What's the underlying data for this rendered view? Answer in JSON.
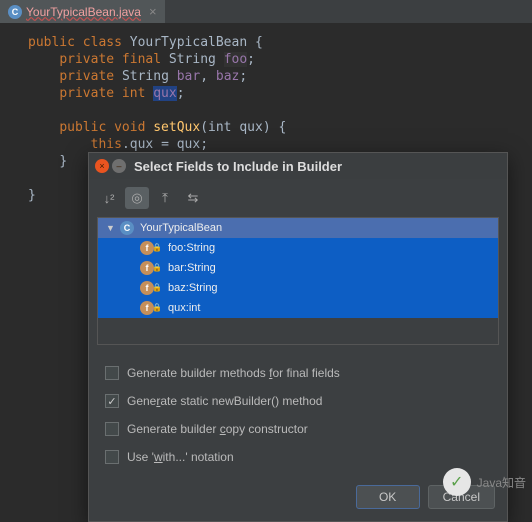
{
  "tab": {
    "filename": "YourTypicalBean.java",
    "icon_letter": "C"
  },
  "code": {
    "class_decl_kw": "public class ",
    "class_name": "YourTypicalBean",
    "lbrace": " {",
    "line1_kw": "private final ",
    "line1_type": "String ",
    "line1_field": "foo",
    "line2_kw": "private ",
    "line2_type": "String ",
    "line2_f1": "bar",
    "line2_f2": "baz",
    "line3_kw": "private int ",
    "line3_field": "qux",
    "semi": ";",
    "comma": ", ",
    "method_kw": "public void ",
    "method_name": "setQux",
    "method_params": "(int qux) {",
    "this": "this",
    "dot_qux": ".qux = qux;",
    "rbrace1": "}",
    "rbrace2": "}"
  },
  "dialog": {
    "title": "Select Fields to Include in Builder",
    "tree": {
      "class": "YourTypicalBean",
      "items": [
        {
          "name": "foo",
          "type": "String"
        },
        {
          "name": "bar",
          "type": "String"
        },
        {
          "name": "baz",
          "type": "String"
        },
        {
          "name": "qux",
          "type": "int"
        }
      ]
    },
    "checks": {
      "final_pre": "Generate builder methods ",
      "final_u": "f",
      "final_post": "or final fields",
      "static_pre": "Gene",
      "static_u": "r",
      "static_post": "ate static newBuilder() method",
      "copy_pre": "Generate builder ",
      "copy_u": "c",
      "copy_post": "opy constructor",
      "with_pre": "Use '",
      "with_u": "w",
      "with_post": "ith...' notation"
    },
    "buttons": {
      "ok": "OK",
      "cancel": "Cancel"
    }
  },
  "watermark": {
    "text": "Java知音",
    "glyph": "✓"
  }
}
